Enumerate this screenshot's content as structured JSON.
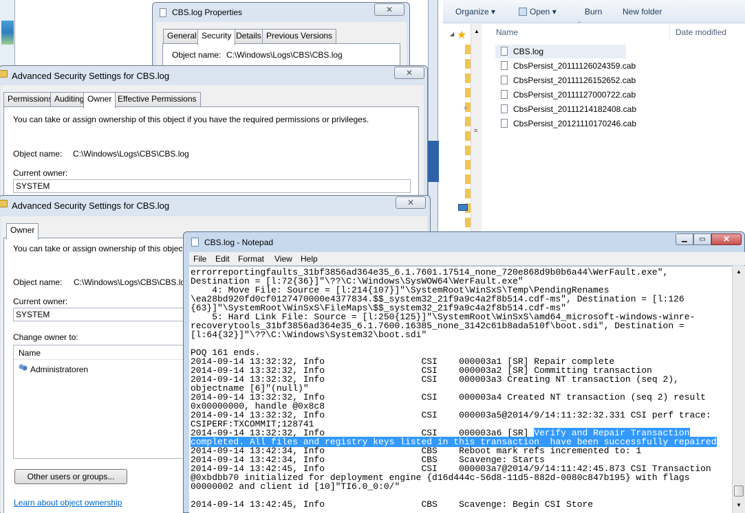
{
  "cbs_properties": {
    "title": "CBS.log Properties",
    "tabs": [
      "General",
      "Security",
      "Details",
      "Previous Versions"
    ],
    "object_name_label": "Object name:",
    "object_name_value": "C:\\Windows\\Logs\\CBS\\CBS.log"
  },
  "adv_security_1": {
    "title": "Advanced Security Settings for CBS.log",
    "tabs": [
      "Permissions",
      "Auditing",
      "Owner",
      "Effective Permissions"
    ],
    "info_text": "You can take or assign ownership of this object if you have the required permissions or privileges.",
    "object_name_label": "Object name:",
    "object_name_value": "C:\\Windows\\Logs\\CBS\\CBS.log",
    "current_owner_label": "Current owner:",
    "current_owner_value": "SYSTEM"
  },
  "adv_security_2": {
    "title": "Advanced Security Settings for CBS.log",
    "tabs": [
      "Owner"
    ],
    "info_text": "You can take or assign ownership of this object if you",
    "object_name_label": "Object name:",
    "object_name_value": "C:\\Windows\\Logs\\CBS\\CBS.log",
    "current_owner_label": "Current owner:",
    "current_owner_value": "SYSTEM",
    "change_owner_label": "Change owner to:",
    "name_column": "Name",
    "owners": [
      "Administratoren"
    ],
    "other_users_button": "Other users or groups...",
    "learn_link": "Learn about object ownership"
  },
  "explorer": {
    "toolbar": [
      "Organize",
      "Open",
      "Burn",
      "New folder"
    ],
    "columns": [
      "Name",
      "Date modified"
    ],
    "files": [
      "CBS.log",
      "CbsPersist_20111126024359.cab",
      "CbsPersist_20111126152652.cab",
      "CbsPersist_20111127000722.cab",
      "CbsPersist_20111214182408.cab",
      "CbsPersist_20121110170246.cab"
    ]
  },
  "notepad": {
    "title": "CBS.log - Notepad",
    "menu": [
      "File",
      "Edit",
      "Format",
      "View",
      "Help"
    ],
    "lines_before": "errorreportingfaults_31bf3856ad364e35_6.1.7601.17514_none_720e868d9b0b6a44\\WerFault.exe\",\nDestination = [l:72{36}]\"\\??\\C:\\Windows\\SysWOW64\\WerFault.exe\"\n    4: Move File: Source = [l:214{107}]\"\\SystemRoot\\WinSxS\\Temp\\PendingRenames\n\\ea28bd920fd0cf0127470000e4377834.$$_system32_21f9a9c4a2f8b514.cdf-ms\", Destination = [l:126\n{63}]\"\\SystemRoot\\WinSxS\\FileMaps\\$$_system32_21f9a9c4a2f8b514.cdf-ms\"\n    5: Hard Link File: Source = [l:250{125}]\"\\SystemRoot\\WinSxS\\amd64_microsoft-windows-winre-\nrecoverytools_31bf3856ad364e35_6.1.7600.16385_none_3142c61b8ada510f\\boot.sdi\", Destination =\n[l:64{32}]\"\\??\\C:\\Windows\\System32\\boot.sdi\"\n\nPOQ 161 ends.\n2014-09-14 13:32:32, Info                  CSI    000003a1 [SR] Repair complete\n2014-09-14 13:32:32, Info                  CSI    000003a2 [SR] Committing transaction\n2014-09-14 13:32:32, Info                  CSI    000003a3 Creating NT transaction (seq 2),\nobjectname [6]\"(null)\"\n2014-09-14 13:32:32, Info                  CSI    000003a4 Created NT transaction (seq 2) result\n0x00000000, handle @0x8c8\n2014-09-14 13:32:32, Info                  CSI    000003a5@2014/9/14:11:32:32.331 CSI perf trace:\nCSIPERF:TXCOMMIT;128741\n2014-09-14 13:32:32, Info                  CSI    000003a6 [SR] ",
    "selected": "Verify and Repair Transaction\ncompleted. All files and registry keys listed in this transaction  have been successfully repaired",
    "lines_after": "\n2014-09-14 13:42:34, Info                  CBS    Reboot mark refs incremented to: 1\n2014-09-14 13:42:34, Info                  CBS    Scavenge: Starts\n2014-09-14 13:42:45, Info                  CSI    000003a7@2014/9/14:11:42:45.873 CSI Transaction\n@0xbdbb70 initialized for deployment engine {d16d444c-56d8-11d5-882d-0080c847b195} with flags\n00000002 and client id [10]\"TI6.0_0:0/\"\n\n2014-09-14 13:42:45, Info                  CBS    Scavenge: Begin CSI Store"
  },
  "colors": {
    "selection": "#3399ff",
    "link": "#0066cc",
    "close_red": "#c75050"
  }
}
